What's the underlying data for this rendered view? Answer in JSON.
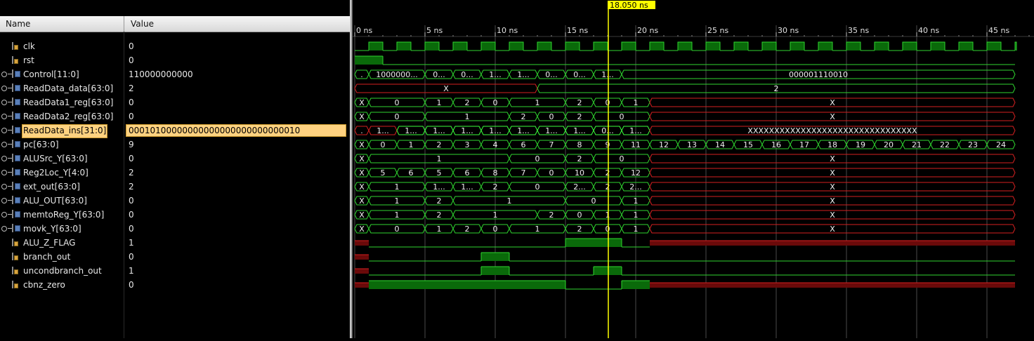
{
  "header": {
    "name_col": "Name",
    "value_col": "Value"
  },
  "cursor": {
    "time_ns": 18.05,
    "label": "18.050 ns"
  },
  "timeline": {
    "labels": [
      "0 ns",
      "5 ns",
      "10 ns",
      "15 ns",
      "20 ns",
      "25 ns",
      "30 ns",
      "35 ns",
      "40 ns",
      "45 ns"
    ]
  },
  "signals": [
    {
      "name": "clk",
      "value": "0",
      "kind": "bit",
      "expandable": false,
      "selected": false
    },
    {
      "name": "rst",
      "value": "0",
      "kind": "bit",
      "expandable": false,
      "selected": false
    },
    {
      "name": "Control[11:0]",
      "value": "110000000000",
      "kind": "bus",
      "expandable": true,
      "selected": false
    },
    {
      "name": "ReadData_data[63:0]",
      "value": "2",
      "kind": "bus",
      "expandable": true,
      "selected": false
    },
    {
      "name": "ReadData1_reg[63:0]",
      "value": "0",
      "kind": "bus",
      "expandable": true,
      "selected": false
    },
    {
      "name": "ReadData2_reg[63:0]",
      "value": "0",
      "kind": "bus",
      "expandable": true,
      "selected": false
    },
    {
      "name": "ReadData_ins[31:0]",
      "value": "00010100000000000000000000000010",
      "kind": "bus",
      "expandable": true,
      "selected": true
    },
    {
      "name": "pc[63:0]",
      "value": "9",
      "kind": "bus",
      "expandable": true,
      "selected": false
    },
    {
      "name": "ALUSrc_Y[63:0]",
      "value": "0",
      "kind": "bus",
      "expandable": true,
      "selected": false
    },
    {
      "name": "Reg2Loc_Y[4:0]",
      "value": "2",
      "kind": "bus",
      "expandable": true,
      "selected": false
    },
    {
      "name": "ext_out[63:0]",
      "value": "2",
      "kind": "bus",
      "expandable": true,
      "selected": false
    },
    {
      "name": "ALU_OUT[63:0]",
      "value": "0",
      "kind": "bus",
      "expandable": true,
      "selected": false
    },
    {
      "name": "memtoReg_Y[63:0]",
      "value": "0",
      "kind": "bus",
      "expandable": true,
      "selected": false
    },
    {
      "name": "movk_Y[63:0]",
      "value": "0",
      "kind": "bus",
      "expandable": true,
      "selected": false
    },
    {
      "name": "ALU_Z_FLAG",
      "value": "1",
      "kind": "bit",
      "expandable": false,
      "selected": false
    },
    {
      "name": "branch_out",
      "value": "0",
      "kind": "bit",
      "expandable": false,
      "selected": false
    },
    {
      "name": "uncondbranch_out",
      "value": "1",
      "kind": "bit",
      "expandable": false,
      "selected": false
    },
    {
      "name": "cbnz_zero",
      "value": "0",
      "kind": "bit",
      "expandable": false,
      "selected": false
    }
  ],
  "waves": [
    {
      "type": "clk",
      "period_ns": 2,
      "high_first": false
    },
    {
      "type": "bit",
      "segs": [
        [
          0,
          2,
          "1"
        ],
        [
          2,
          47,
          "0"
        ]
      ]
    },
    {
      "type": "bus",
      "segs": [
        [
          0,
          1,
          "."
        ],
        [
          1,
          5,
          "1000000..."
        ],
        [
          5,
          7,
          "0..."
        ],
        [
          7,
          9,
          "0..."
        ],
        [
          9,
          11,
          "1..."
        ],
        [
          11,
          13,
          "1..."
        ],
        [
          13,
          15,
          "0..."
        ],
        [
          15,
          17,
          "0..."
        ],
        [
          17,
          19,
          "1..."
        ],
        [
          19,
          47,
          "000001110010"
        ]
      ]
    },
    {
      "type": "bus",
      "segs": [
        [
          0,
          13,
          "X",
          "red"
        ],
        [
          13,
          47,
          "2"
        ]
      ]
    },
    {
      "type": "bus",
      "segs": [
        [
          0,
          1,
          "X"
        ],
        [
          1,
          5,
          "0"
        ],
        [
          5,
          7,
          "1"
        ],
        [
          7,
          9,
          "2"
        ],
        [
          9,
          11,
          "0"
        ],
        [
          11,
          15,
          "1"
        ],
        [
          15,
          17,
          "2"
        ],
        [
          17,
          19,
          "0"
        ],
        [
          19,
          21,
          "1"
        ],
        [
          21,
          47,
          "X",
          "red"
        ]
      ]
    },
    {
      "type": "bus",
      "segs": [
        [
          0,
          1,
          "X"
        ],
        [
          1,
          5,
          "0"
        ],
        [
          5,
          11,
          "1"
        ],
        [
          11,
          13,
          "2"
        ],
        [
          13,
          15,
          "0"
        ],
        [
          15,
          17,
          "2"
        ],
        [
          17,
          21,
          "0"
        ],
        [
          21,
          47,
          "X",
          "red"
        ]
      ]
    },
    {
      "type": "bus",
      "segs": [
        [
          0,
          1,
          ".",
          "red"
        ],
        [
          1,
          3,
          "1...",
          "red"
        ],
        [
          3,
          5,
          "1..."
        ],
        [
          5,
          7,
          "1..."
        ],
        [
          7,
          9,
          "1..."
        ],
        [
          9,
          11,
          "1..."
        ],
        [
          11,
          13,
          "1..."
        ],
        [
          13,
          15,
          "1..."
        ],
        [
          15,
          17,
          "1..."
        ],
        [
          17,
          19,
          "0..."
        ],
        [
          19,
          21,
          "1..."
        ],
        [
          21,
          47,
          "XXXXXXXXXXXXXXXXXXXXXXXXXXXXXXXX",
          "red"
        ]
      ]
    },
    {
      "type": "bus",
      "segs": [
        [
          0,
          1,
          "X"
        ],
        [
          1,
          3,
          "0"
        ],
        [
          3,
          5,
          "1"
        ],
        [
          5,
          7,
          "2"
        ],
        [
          7,
          9,
          "3"
        ],
        [
          9,
          11,
          "4"
        ],
        [
          11,
          13,
          "6"
        ],
        [
          13,
          15,
          "7"
        ],
        [
          15,
          17,
          "8"
        ],
        [
          17,
          19,
          "9"
        ],
        [
          19,
          21,
          "11"
        ],
        [
          21,
          23,
          "12"
        ],
        [
          23,
          25,
          "13"
        ],
        [
          25,
          27,
          "14"
        ],
        [
          27,
          29,
          "15"
        ],
        [
          29,
          31,
          "16"
        ],
        [
          31,
          33,
          "17"
        ],
        [
          33,
          35,
          "18"
        ],
        [
          35,
          37,
          "19"
        ],
        [
          37,
          39,
          "20"
        ],
        [
          39,
          41,
          "21"
        ],
        [
          41,
          43,
          "22"
        ],
        [
          43,
          45,
          "23"
        ],
        [
          45,
          47,
          "24"
        ]
      ]
    },
    {
      "type": "bus",
      "segs": [
        [
          0,
          1,
          "X"
        ],
        [
          1,
          11,
          "1"
        ],
        [
          11,
          15,
          "0"
        ],
        [
          15,
          17,
          "2"
        ],
        [
          17,
          21,
          "0"
        ],
        [
          21,
          47,
          "X",
          "red"
        ]
      ]
    },
    {
      "type": "bus",
      "segs": [
        [
          0,
          1,
          "X"
        ],
        [
          1,
          3,
          "5"
        ],
        [
          3,
          5,
          "6"
        ],
        [
          5,
          7,
          "5"
        ],
        [
          7,
          9,
          "6"
        ],
        [
          9,
          11,
          "8"
        ],
        [
          11,
          13,
          "7"
        ],
        [
          13,
          15,
          "0"
        ],
        [
          15,
          17,
          "10"
        ],
        [
          17,
          19,
          "2"
        ],
        [
          19,
          21,
          "12"
        ],
        [
          21,
          47,
          "X",
          "red"
        ]
      ]
    },
    {
      "type": "bus",
      "segs": [
        [
          0,
          1,
          "X"
        ],
        [
          1,
          5,
          "1"
        ],
        [
          5,
          7,
          "1..."
        ],
        [
          7,
          9,
          "1..."
        ],
        [
          9,
          11,
          "2"
        ],
        [
          11,
          15,
          "0"
        ],
        [
          15,
          17,
          "2..."
        ],
        [
          17,
          19,
          "2"
        ],
        [
          19,
          21,
          "2..."
        ],
        [
          21,
          47,
          "X",
          "red"
        ]
      ]
    },
    {
      "type": "bus",
      "segs": [
        [
          0,
          1,
          "X"
        ],
        [
          1,
          5,
          "1"
        ],
        [
          5,
          7,
          "2"
        ],
        [
          7,
          15,
          "1"
        ],
        [
          15,
          19,
          "0"
        ],
        [
          19,
          21,
          "1"
        ],
        [
          21,
          47,
          "X",
          "red"
        ]
      ]
    },
    {
      "type": "bus",
      "segs": [
        [
          0,
          1,
          "X"
        ],
        [
          1,
          5,
          "1"
        ],
        [
          5,
          7,
          "2"
        ],
        [
          7,
          13,
          "1"
        ],
        [
          13,
          15,
          "2"
        ],
        [
          15,
          17,
          "0"
        ],
        [
          17,
          19,
          "1"
        ],
        [
          19,
          21,
          "1"
        ],
        [
          21,
          47,
          "X",
          "red"
        ]
      ]
    },
    {
      "type": "bus",
      "segs": [
        [
          0,
          1,
          "X"
        ],
        [
          1,
          5,
          "0"
        ],
        [
          5,
          7,
          "1"
        ],
        [
          7,
          9,
          "2"
        ],
        [
          9,
          11,
          "0"
        ],
        [
          11,
          15,
          "1"
        ],
        [
          15,
          17,
          "2"
        ],
        [
          17,
          19,
          "0"
        ],
        [
          19,
          21,
          "1"
        ],
        [
          21,
          47,
          "X",
          "red"
        ]
      ]
    },
    {
      "type": "bit",
      "segs": [
        [
          0,
          1,
          "X"
        ],
        [
          1,
          15,
          "0"
        ],
        [
          15,
          19,
          "1"
        ],
        [
          19,
          21,
          "0"
        ],
        [
          21,
          47,
          "X"
        ]
      ]
    },
    {
      "type": "bit",
      "segs": [
        [
          0,
          1,
          "X"
        ],
        [
          1,
          9,
          "0"
        ],
        [
          9,
          11,
          "1"
        ],
        [
          11,
          47,
          "0"
        ]
      ]
    },
    {
      "type": "bit",
      "segs": [
        [
          0,
          1,
          "X"
        ],
        [
          1,
          9,
          "0"
        ],
        [
          9,
          11,
          "1"
        ],
        [
          11,
          17,
          "0"
        ],
        [
          17,
          19,
          "1"
        ],
        [
          19,
          47,
          "0"
        ]
      ]
    },
    {
      "type": "bit",
      "segs": [
        [
          0,
          1,
          "X"
        ],
        [
          1,
          15,
          "1"
        ],
        [
          15,
          19,
          "0"
        ],
        [
          19,
          21,
          "1"
        ],
        [
          21,
          47,
          "X"
        ]
      ]
    }
  ]
}
